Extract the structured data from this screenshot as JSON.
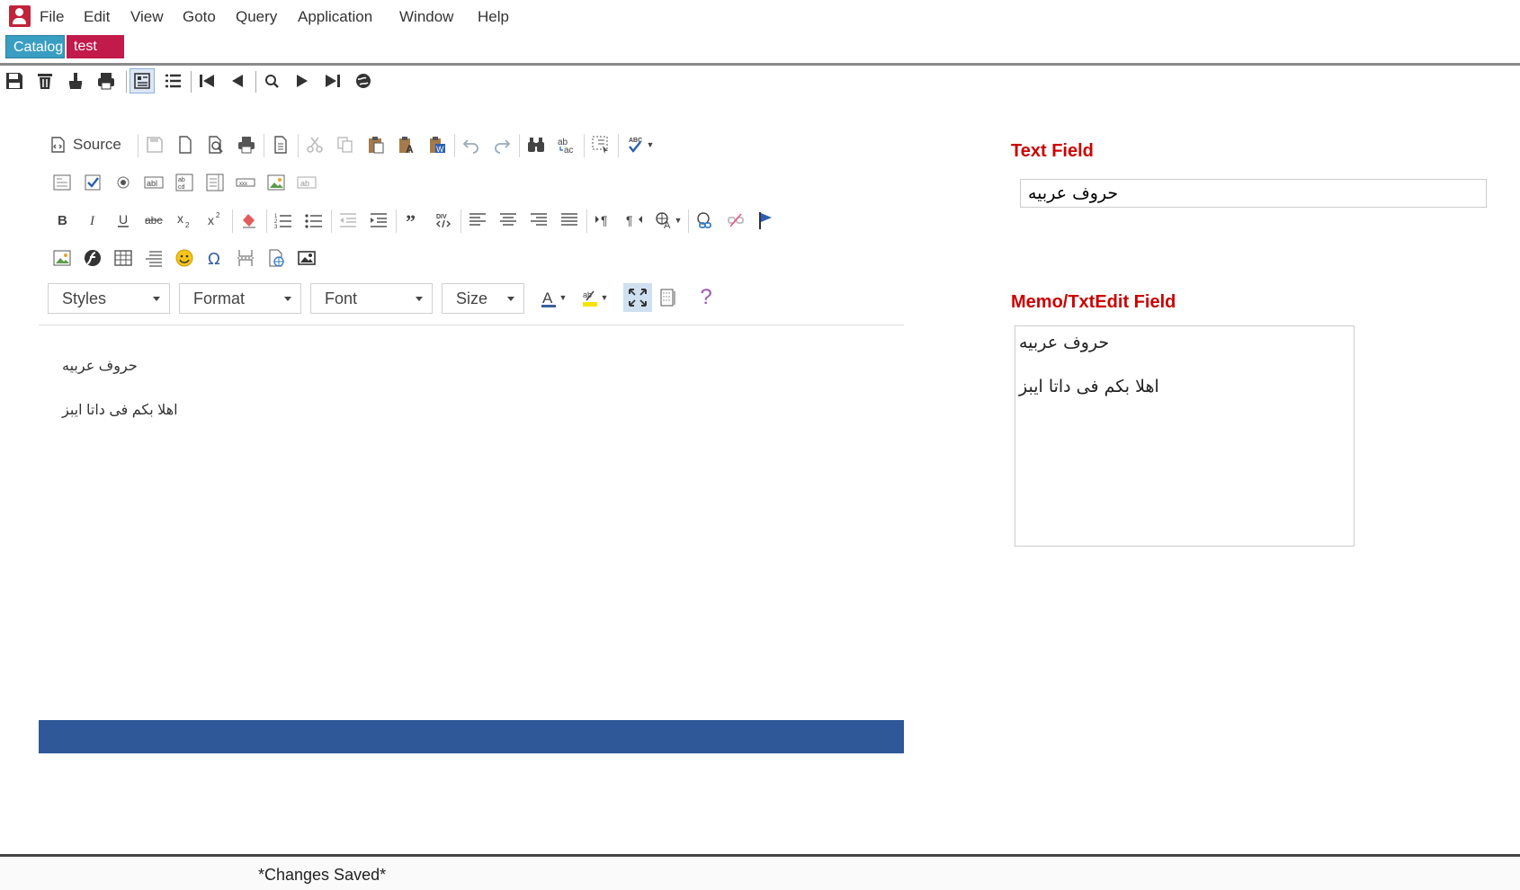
{
  "menu": [
    "File",
    "Edit",
    "View",
    "Goto",
    "Query",
    "Application",
    "Window",
    "Help"
  ],
  "tabs": [
    "Catalog",
    "test"
  ],
  "editor": {
    "source_label": "Source",
    "combos": {
      "styles": "Styles",
      "format": "Format",
      "font": "Font",
      "size": "Size"
    },
    "help_glyph": "?",
    "content": [
      "حروف عربيه",
      "اهلا بكم فى داتا ايبز"
    ]
  },
  "text_field": {
    "label": "Text Field",
    "value": "حروف عربيه"
  },
  "memo_field": {
    "label": "Memo/TxtEdit Field",
    "lines": [
      "حروف عربيه",
      "اهلا بكم فى داتا ايبز"
    ]
  },
  "status": "*Changes Saved*",
  "colors": {
    "accent_red": "#cc0000",
    "tab_catalog": "#3a9ec2",
    "tab_test": "#c21a4a",
    "editor_bar": "#2e5898"
  }
}
